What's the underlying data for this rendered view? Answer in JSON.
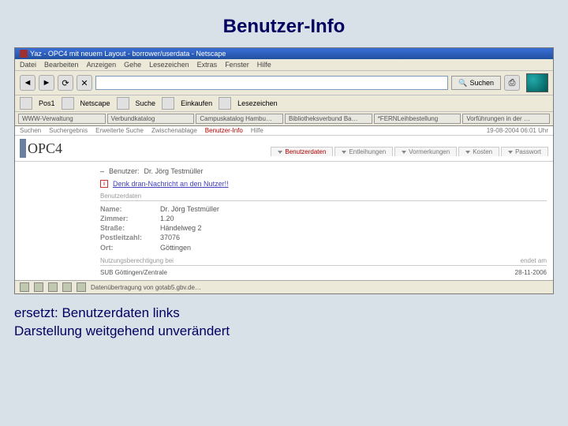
{
  "slide": {
    "title": "Benutzer-Info",
    "note1": "ersetzt: Benutzerdaten links",
    "note2": "Darstellung weitgehend unverändert"
  },
  "window": {
    "title": "Yaz - OPC4 mit neuem Layout - borrower/userdata - Netscape"
  },
  "menubar": [
    "Datei",
    "Bearbeiten",
    "Anzeigen",
    "Gehe",
    "Lesezeichen",
    "Extras",
    "Fenster",
    "Hilfe"
  ],
  "nav": {
    "url_placeholder": "",
    "url_value": "",
    "search_label": "Suchen"
  },
  "toolbar2": [
    "Pos1",
    "Netscape",
    "Suche",
    "Einkaufen",
    "Lesezeichen"
  ],
  "bookmarks": [
    "WWW-Verwaltung",
    "Verbundkatalog",
    "Campuskatalog Hambu…",
    "Bibliotheksverbund Ba…",
    "*FERNLeihbestellung",
    "Vorführungen in der …"
  ],
  "opc": {
    "logo": "OPC4",
    "navtabs": [
      "Suchen",
      "Suchergebnis",
      "Erweiterte Suche",
      "Zwischenablage",
      "Benutzer-Info",
      "Hilfe"
    ],
    "active_nav": "Benutzer-Info",
    "timestamp": "19-08-2004 06:01 Uhr",
    "subtabs": [
      "Benutzerdaten",
      "Entleihungen",
      "Vormerkungen",
      "Kosten",
      "Passwort"
    ],
    "active_sub": "Benutzerdaten"
  },
  "user": {
    "label": "Benutzer:",
    "display": "Dr. Jörg Testmüller"
  },
  "alert": {
    "text": "Denk dran-Nachricht an den Nutzer!!"
  },
  "userdata": {
    "heading": "Benutzerdaten",
    "fields": [
      {
        "k": "Name:",
        "v": "Dr. Jörg Testmüller"
      },
      {
        "k": "Zimmer:",
        "v": "1.20"
      },
      {
        "k": "Straße:",
        "v": "Händelweg 2"
      },
      {
        "k": "Postleitzahl:",
        "v": "37076"
      },
      {
        "k": "Ort:",
        "v": "Göttingen"
      }
    ]
  },
  "entitlement": {
    "header_left": "Nutzungsberechtigung bei",
    "header_right": "endet am",
    "row_left": "SUB Göttingen/Zentrale",
    "row_right": "28-11-2006"
  },
  "statusbar": {
    "text": "Datenübertragung von gotab5.gbv.de…"
  }
}
